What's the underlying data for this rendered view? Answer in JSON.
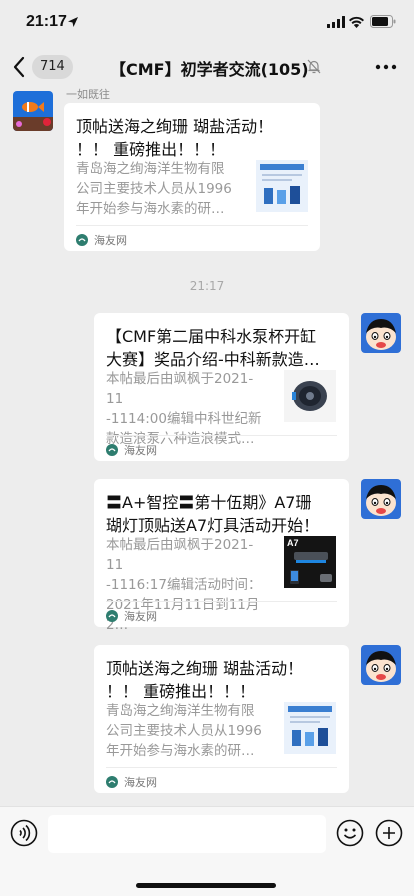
{
  "status_bar": {
    "time": "21:17"
  },
  "nav": {
    "unread_count": "714",
    "title": "【CMF】初学者交流(105)"
  },
  "timestamp": "21:17",
  "messages": [
    {
      "sender": "一如既往",
      "title_lines": [
        "顶帖送海之绚珊 瑚盐活动！",
        "！！ 重磅推出！！！"
      ],
      "desc_lines": [
        "青岛海之绚海洋生物有限",
        "公司主要技术人员从1996",
        "年开始参与海水素的研…"
      ],
      "thumb_icon": "reef-salt-product-thumbnail",
      "source": "海友网"
    },
    {
      "title_lines": [
        "【CMF第二届中科水泵杯开缸",
        "大赛】奖品介绍-中科新款造…"
      ],
      "desc_lines": [
        "本帖最后由飒枫于2021-11",
        "-1114:00编辑中科世纪新",
        "款造浪泵六种造浪模式…"
      ],
      "thumb_icon": "wave-pump-thumbnail",
      "source": "海友网"
    },
    {
      "title_lines": [
        "〓A+智控〓第十伍期》A7珊",
        "瑚灯顶贴送A7灯具活动开始！"
      ],
      "desc_lines": [
        "本帖最后由飒枫于2021-11",
        "-1116:17编辑活动时间：",
        "2021年11月11日到11月2…"
      ],
      "thumb_icon": "a7-coral-light-thumbnail",
      "thumb_text": "A7",
      "source": "海友网"
    },
    {
      "title_lines": [
        "顶帖送海之绚珊 瑚盐活动！",
        "！！ 重磅推出！！！"
      ],
      "desc_lines": [
        "青岛海之绚海洋生物有限",
        "公司主要技术人员从1996",
        "年开始参与海水素的研…"
      ],
      "thumb_icon": "reef-salt-product-thumbnail",
      "source": "海友网"
    }
  ],
  "colors": {
    "background": "#ededed",
    "card": "#ffffff",
    "muted_text": "#999999"
  }
}
